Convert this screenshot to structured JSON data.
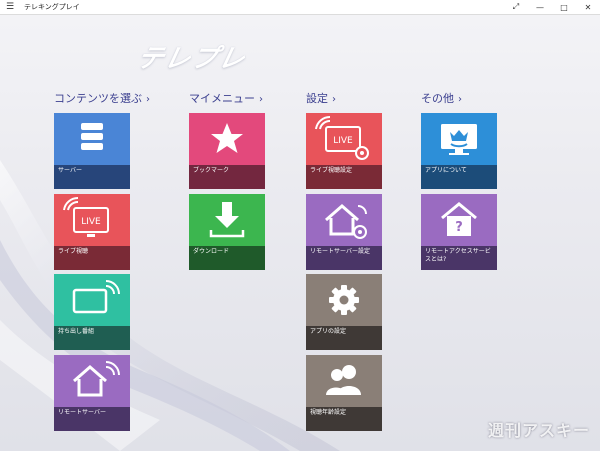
{
  "window": {
    "title": "テレキングプレイ",
    "menu_icon": "hamburger-icon",
    "controls": [
      "resize-icon",
      "minimize-icon",
      "maximize-icon",
      "close-icon"
    ]
  },
  "logo": "テレプレ",
  "sections": [
    {
      "heading": "コンテンツを選ぶ",
      "tiles": [
        {
          "label": "サーバー",
          "icon": "server-icon",
          "top": "#4a85d6",
          "bottom": "#27457a"
        },
        {
          "label": "ライブ視聴",
          "icon": "live-tv-icon",
          "top": "#e8545a",
          "bottom": "#7a2a36"
        },
        {
          "label": "持ち出し番組",
          "icon": "remote-screen-icon",
          "top": "#2fc0a1",
          "bottom": "#1f5e52"
        },
        {
          "label": "リモートサーバー",
          "icon": "remote-house-icon",
          "top": "#9a6bc1",
          "bottom": "#4a3567"
        }
      ]
    },
    {
      "heading": "マイメニュー",
      "tiles": [
        {
          "label": "ブックマーク",
          "icon": "star-icon",
          "top": "#e3497c",
          "bottom": "#73273f"
        },
        {
          "label": "ダウンロード",
          "icon": "download-icon",
          "top": "#3cb64f",
          "bottom": "#1f5a2a"
        }
      ]
    },
    {
      "heading": "設定",
      "tiles": [
        {
          "label": "ライブ視聴設定",
          "icon": "live-tv-settings-icon",
          "top": "#e8545a",
          "bottom": "#7a2a36"
        },
        {
          "label": "リモートサーバー設定",
          "icon": "remote-house-settings-icon",
          "top": "#9a6bc1",
          "bottom": "#4a3567"
        },
        {
          "label": "アプリの設定",
          "icon": "gear-icon",
          "top": "#8a7f77",
          "bottom": "#3f3936"
        },
        {
          "label": "視聴年齢設定",
          "icon": "users-icon",
          "top": "#8a7f77",
          "bottom": "#3f3936"
        }
      ]
    },
    {
      "heading": "その他",
      "tiles": [
        {
          "label": "アプリについて",
          "icon": "app-info-icon",
          "top": "#2d8fd8",
          "bottom": "#1c4c79"
        },
        {
          "label": "リモートアクセスサービスとは?",
          "icon": "help-house-icon",
          "top": "#9a6bc1",
          "bottom": "#4a3567"
        }
      ]
    }
  ],
  "watermark": "週刊アスキー"
}
